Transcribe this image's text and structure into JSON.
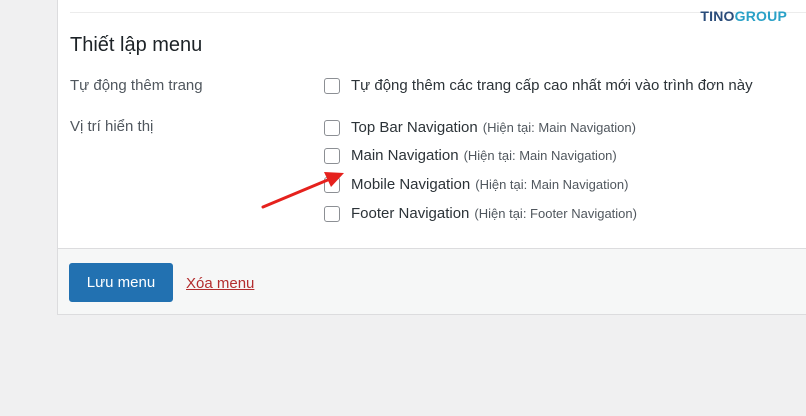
{
  "watermark": {
    "part1": "TINO",
    "part2": "GROUP"
  },
  "section": {
    "title": "Thiết lập menu"
  },
  "auto_add": {
    "label": "Tự động thêm trang",
    "option": "Tự động thêm các trang cấp cao nhất mới vào trình đơn này",
    "checked": false
  },
  "display_location": {
    "label": "Vị trí hiển thị",
    "options": [
      {
        "label": "Top Bar Navigation",
        "hint": "(Hiện tại: Main Navigation)",
        "checked": false
      },
      {
        "label": "Main Navigation",
        "hint": "(Hiện tại: Main Navigation)",
        "checked": false
      },
      {
        "label": "Mobile Navigation",
        "hint": "(Hiện tại: Main Navigation)",
        "checked": false
      },
      {
        "label": "Footer Navigation",
        "hint": "(Hiện tại: Footer Navigation)",
        "checked": false
      }
    ]
  },
  "actions": {
    "save_label": "Lưu menu",
    "delete_label": "Xóa menu"
  },
  "colors": {
    "primary_button": "#2271b1",
    "delete_link": "#b32d2e",
    "annotation_arrow": "#e5211d"
  }
}
